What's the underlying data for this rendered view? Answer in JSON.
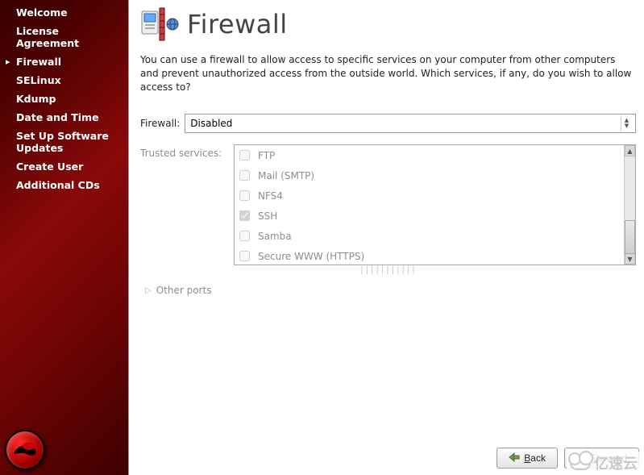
{
  "sidebar": {
    "items": [
      {
        "label": "Welcome"
      },
      {
        "label": "License Agreement"
      },
      {
        "label": "Firewall",
        "active": true
      },
      {
        "label": "SELinux"
      },
      {
        "label": "Kdump"
      },
      {
        "label": "Date and Time"
      },
      {
        "label": "Set Up Software Updates"
      },
      {
        "label": "Create User"
      },
      {
        "label": "Additional CDs"
      }
    ]
  },
  "header": {
    "title": "Firewall",
    "icon": "firewall-icon"
  },
  "description": "You can use a firewall to allow access to specific services on your computer from other computers and prevent unauthorized access from the outside world.  Which services, if any, do you wish to allow access to?",
  "firewall_row": {
    "label": "Firewall:",
    "value": "Disabled"
  },
  "trusted": {
    "label": "Trusted services:",
    "services": [
      {
        "name": "FTP",
        "checked": false
      },
      {
        "name": "Mail (SMTP)",
        "checked": false
      },
      {
        "name": "NFS4",
        "checked": false
      },
      {
        "name": "SSH",
        "checked": true
      },
      {
        "name": "Samba",
        "checked": false
      },
      {
        "name": "Secure WWW (HTTPS)",
        "checked": false
      }
    ]
  },
  "other_ports": {
    "label": "Other ports"
  },
  "buttons": {
    "back": "Back",
    "forward": "Forward"
  },
  "watermark": "亿速云"
}
